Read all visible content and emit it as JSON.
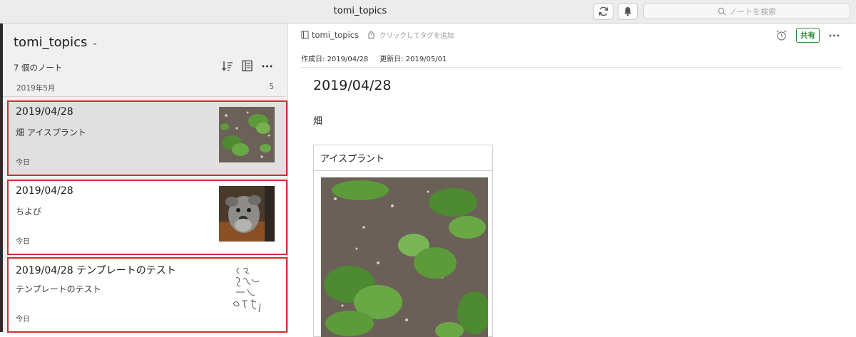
{
  "window": {
    "title": "tomi_topics",
    "search_placeholder": "ノートを検索",
    "sync_icon": "sync-icon",
    "bell_icon": "bell-icon"
  },
  "sidebar": {
    "notebook_title": "tomi_topics",
    "note_count": "7 個のノート",
    "group": {
      "label": "2019年5月",
      "count": "5"
    },
    "notes": [
      {
        "title": "2019/04/28",
        "snippet": "畑 アイスプラント",
        "date": "今日",
        "thumb": "plants-photo"
      },
      {
        "title": "2019/04/28",
        "snippet": "ちよび",
        "date": "今日",
        "thumb": "dog-photo"
      },
      {
        "title": "2019/04/28 テンプレートのテスト",
        "snippet": "テンプレートのテスト",
        "date": "今日",
        "thumb": "handwriting-sketch"
      }
    ]
  },
  "editor": {
    "notebook": "tomi_topics",
    "tag_placeholder": "クリックしてタグを追加",
    "share_label": "共有",
    "created": "作成日: 2019/04/28",
    "updated": "更新日: 2019/05/01",
    "title": "2019/04/28",
    "body": "畑",
    "table_header": "アイスプラント"
  },
  "colors": {
    "selection_border": "#d12e2e",
    "share_green": "#2e8b3a"
  }
}
